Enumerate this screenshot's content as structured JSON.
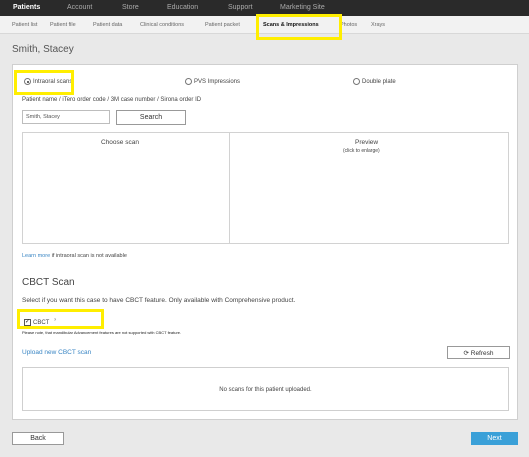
{
  "top_nav": [
    "Patients",
    "Account",
    "Store",
    "Education",
    "Support",
    "Marketing Site"
  ],
  "sub_nav": [
    "Patient list",
    "Patient file",
    "Patient data",
    "Clinical conditions",
    "Patient packet",
    "Scans & Impressions",
    "Photos",
    "Xrays"
  ],
  "patient_name": "Smith, Stacey",
  "scan_options": {
    "intraoral": "Intraoral scans",
    "pvs": "PVS Impressions",
    "doubleplate": "Double plate"
  },
  "search": {
    "label": "Patient name / iTero order code / 3M case number / Sirona order ID",
    "value": "Smith, Stacey",
    "button": "Search"
  },
  "scan_table": {
    "choose": "Choose scan",
    "preview": "Preview",
    "preview_hint": "(click to enlarge)"
  },
  "learn_more": {
    "link": "Learn more",
    "text": " if intraoral scan is not available"
  },
  "cbct": {
    "title": "CBCT Scan",
    "description": "Select if you want this case to have CBCT feature. Only available with Comprehensive product.",
    "checkbox_label": "CBCT",
    "info_marker": "?",
    "note": "Please note, that mandibular Advancement features are not supported with CBCT feature.",
    "upload_link": "Upload new CBCT scan",
    "refresh": "Refresh",
    "empty": "No scans for this patient uploaded."
  },
  "footer": {
    "back": "Back",
    "next": "Next"
  }
}
